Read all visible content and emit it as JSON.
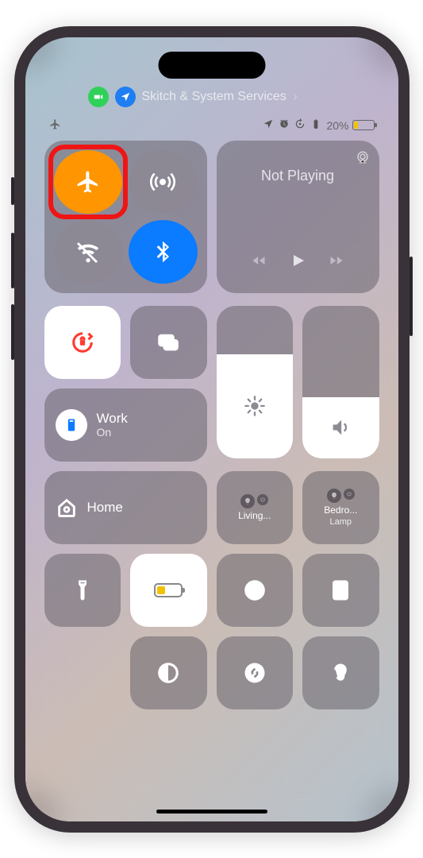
{
  "pills": {
    "label": "Skitch & System Services"
  },
  "status": {
    "battery_pct": "20%"
  },
  "media": {
    "title": "Not Playing"
  },
  "focus": {
    "title": "Work",
    "subtitle": "On"
  },
  "home": {
    "label": "Home"
  },
  "accessories": [
    {
      "line1": "Living..."
    },
    {
      "line1": "Bedro...",
      "line2": "Lamp"
    }
  ]
}
